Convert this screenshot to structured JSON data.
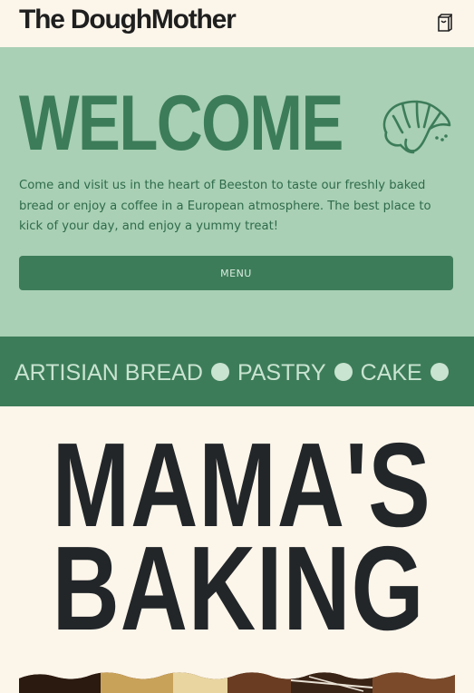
{
  "header": {
    "brand": "The DoughMother",
    "cart_icon": "shopping-bag-icon"
  },
  "hero": {
    "title": "WELCOME",
    "icon": "croissant-icon",
    "intro": "Come and visit us in the heart of Beeston to taste our freshly baked bread or enjoy a coffee in a European atmosphere. The best place to kick of your day, and enjoy a yummy treat!",
    "menu_button": "MENU"
  },
  "ticker": {
    "items": [
      "ARTISIAN BREAD",
      "PASTRY",
      "CAKE"
    ]
  },
  "section": {
    "heading_line1": "MAMA'S",
    "heading_line2": "BAKING"
  },
  "colors": {
    "background": "#fcf5ea",
    "hero_bg": "#a9d0b4",
    "accent_green": "#3d7c59",
    "ticker_text": "#c9e4d1",
    "heading_dark": "#222629"
  }
}
